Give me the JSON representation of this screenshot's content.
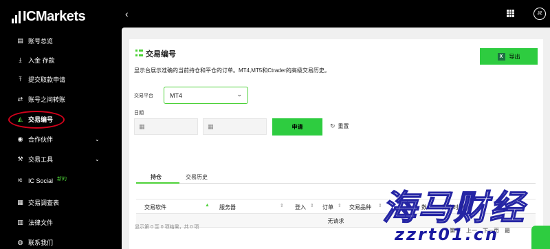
{
  "logo": {
    "text": "IC",
    "text2": "Markets"
  },
  "sidebar": {
    "items": [
      {
        "label": "账号总览",
        "icon": "report-icon"
      },
      {
        "label": "入金 存款",
        "icon": "deposit-icon"
      },
      {
        "label": "提交取款申请",
        "icon": "withdraw-icon"
      },
      {
        "label": "账号之间转账",
        "icon": "transfer-icon"
      },
      {
        "label": "交易编号",
        "icon": "chart-icon",
        "active": true
      },
      {
        "label": "合作伙伴",
        "icon": "partner-icon",
        "chevron": "⌄"
      },
      {
        "label": "交易工具",
        "icon": "tools-icon",
        "chevron": "⌄"
      },
      {
        "label": "IC Social",
        "icon": "ic-social-icon",
        "badge": "新的"
      },
      {
        "label": "交易调查表",
        "icon": "survey-icon"
      },
      {
        "label": "法律文件",
        "icon": "legal-icon"
      },
      {
        "label": "联系我们",
        "icon": "contact-icon"
      }
    ]
  },
  "topbar": {
    "back": "‹",
    "avatar": "JZ"
  },
  "page": {
    "title": "交易编号",
    "export_label": "导出",
    "export_icon_text": "X",
    "description": "显示台展示准确的当前持仓和平仓的订单。MT4,MT5和Ctrader的高级交易历史。",
    "platform_label": "交易平台",
    "platform_value": "MT4",
    "date_label": "日期",
    "apply_label": "申请",
    "reset_label": "重置"
  },
  "tabs": [
    {
      "label": "持仓",
      "active": true
    },
    {
      "label": "交易历史",
      "active": false
    }
  ],
  "table": {
    "columns": [
      "交易软件",
      "服务器",
      "登入",
      "订单",
      "交易品种",
      "数",
      "开仓时间"
    ],
    "empty_text": "无请求",
    "info": "显示第 0 至 0 项结果，共 0 项",
    "pager": [
      "第一",
      "上一",
      "下一页",
      "最"
    ]
  },
  "watermark": {
    "title": "海马财经",
    "url": "zzrt01.cn"
  },
  "colors": {
    "accent": "#2ecc40",
    "annotation": "#d0021b",
    "watermark": "#1a1aa0"
  }
}
